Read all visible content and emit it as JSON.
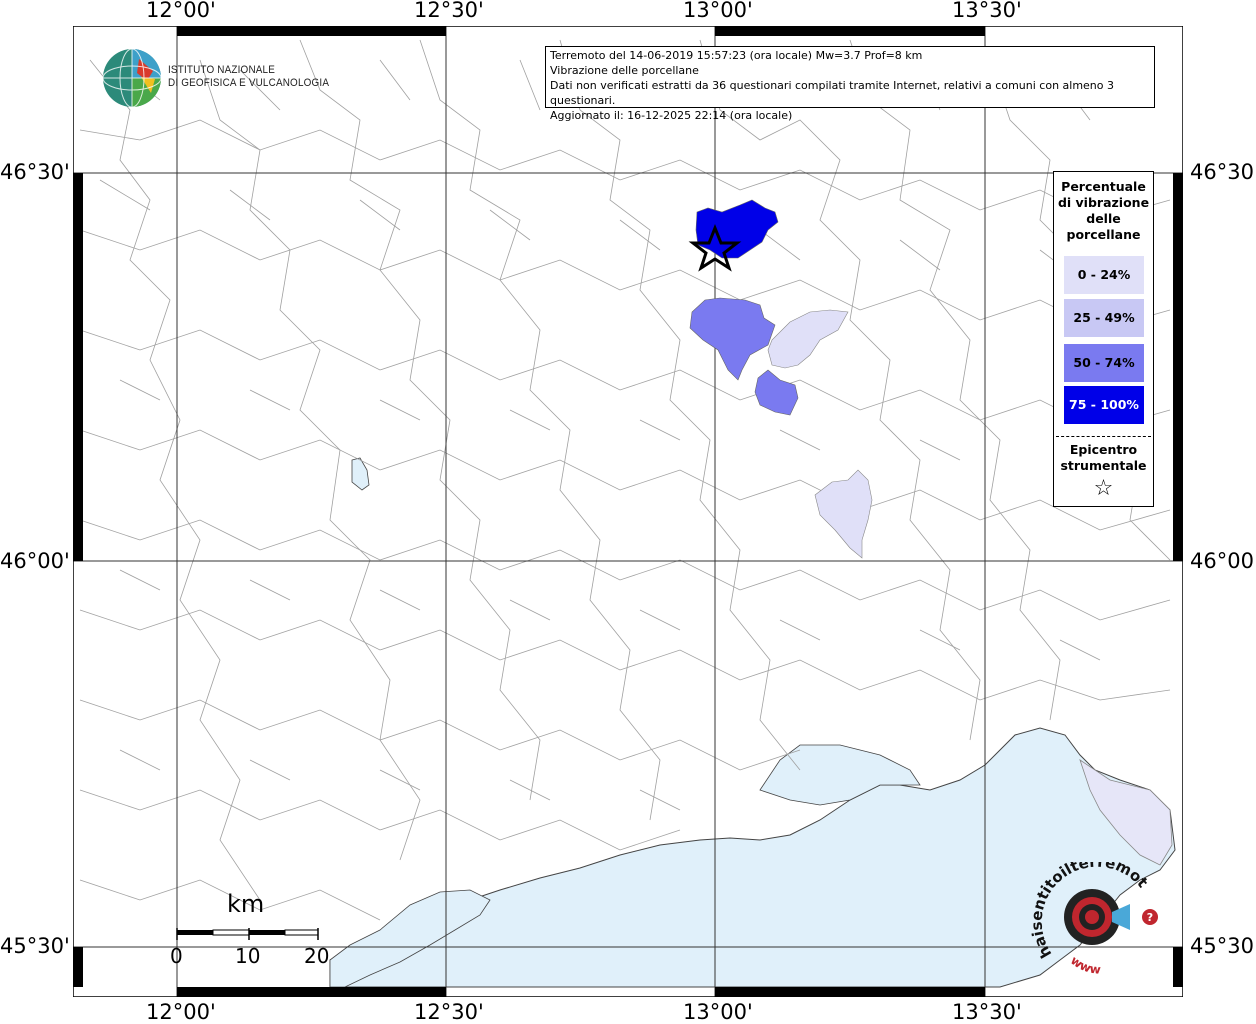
{
  "map": {
    "lon_labels": [
      "12°00'",
      "12°30'",
      "13°00'",
      "13°30'"
    ],
    "lat_labels": [
      "46°30'",
      "46°00'",
      "45°30'"
    ],
    "colors": {
      "land": "#ffffff",
      "sea": "#e0f0fa",
      "boundary": "#9a9a9a",
      "class_0_24": "#e0e0f8",
      "class_25_49": "#c8c8f4",
      "class_50_74": "#7a7af0",
      "class_75_100": "#0000e8"
    }
  },
  "info": {
    "line1": "Terremoto del 14-06-2019 15:57:23 (ora locale) Mw=3.7 Prof=8 km",
    "line2": "Vibrazione delle porcellane",
    "line3": "Dati non verificati estratti da 36 questionari compilati tramite Internet, relativi a comuni con almeno 3 questionari.",
    "line4": "Aggiornato il: 16-12-2025 22:14 (ora locale)"
  },
  "legend": {
    "title": "Percentuale di vibrazione delle porcellane",
    "classes": [
      "0 - 24%",
      "25 - 49%",
      "50 - 74%",
      "75 - 100%"
    ],
    "epicenter_label": "Epicentro strumentale",
    "epicenter_icon": "star-outline-icon"
  },
  "logo": {
    "line1": "ISTITUTO NAZIONALE",
    "line2": "DI GEOFISICA E VULCANOLOGIA"
  },
  "scalebar": {
    "unit": "km",
    "ticks": [
      "0",
      "10",
      "20"
    ]
  },
  "stamp": {
    "text": "haisentitoilterremoto.it",
    "url": "www",
    "question": "?"
  }
}
